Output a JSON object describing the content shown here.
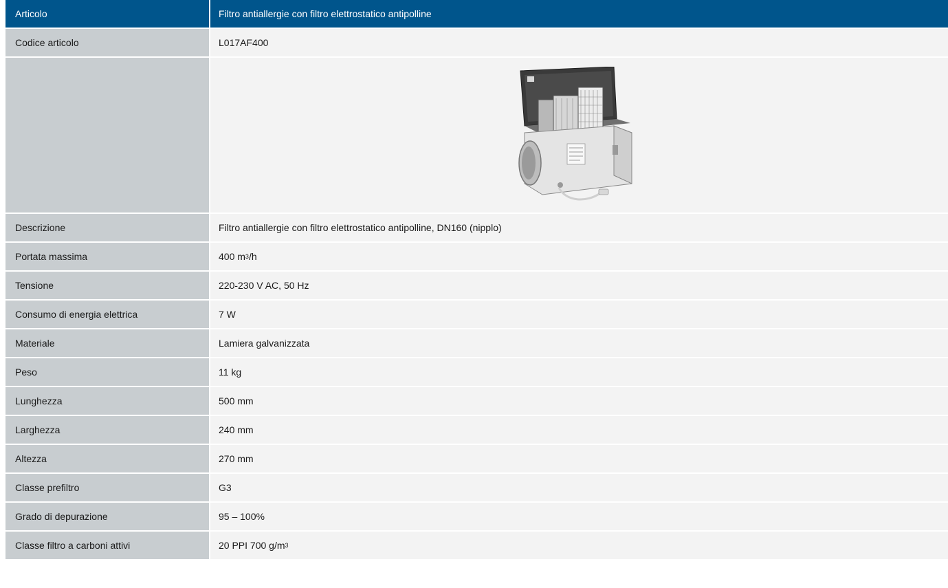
{
  "header": {
    "label": "Articolo",
    "value": "Filtro antiallergie con filtro elettrostatico antipolline"
  },
  "rows": [
    {
      "label": "Codice articolo",
      "value": "L017AF400"
    },
    {
      "label": "Descrizione",
      "value": "Filtro antiallergie con filtro elettrostatico antipolline, DN160 (nipplo)"
    },
    {
      "label": "Portata massima",
      "value": "400 m",
      "sup": "3",
      "suffix": "/h"
    },
    {
      "label": "Tensione",
      "value": "220-230 V AC, 50 Hz"
    },
    {
      "label": "Consumo di energia elettrica",
      "value": "7 W"
    },
    {
      "label": "Materiale",
      "value": "Lamiera galvanizzata"
    },
    {
      "label": "Peso",
      "value": "11 kg"
    },
    {
      "label": "Lunghezza",
      "value": "500 mm"
    },
    {
      "label": "Larghezza",
      "value": "240 mm"
    },
    {
      "label": "Altezza",
      "value": "270 mm"
    },
    {
      "label": "Classe prefiltro",
      "value": "G3"
    },
    {
      "label": "Grado di depurazione",
      "value": "95 – 100%"
    },
    {
      "label": "Classe filtro a carboni attivi",
      "value": "20 PPI 700 g/m",
      "sup": "3",
      "suffix": ""
    }
  ],
  "colors": {
    "header_bg": "#00558c",
    "label_bg": "#c8cdd0",
    "value_bg": "#f3f3f3"
  }
}
